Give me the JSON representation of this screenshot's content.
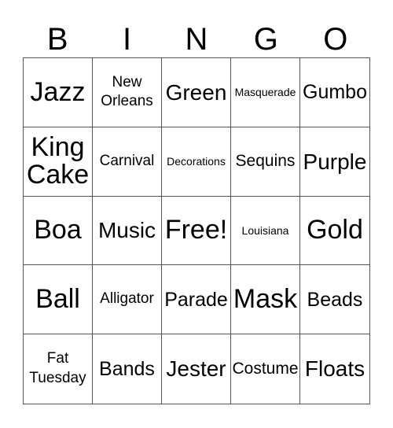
{
  "header": {
    "letters": [
      "B",
      "I",
      "N",
      "G",
      "O"
    ]
  },
  "cells": [
    {
      "text": "Jazz",
      "size": "s-xl"
    },
    {
      "text": "New Orleans",
      "size": "s-sm"
    },
    {
      "text": "Green",
      "size": "s-l"
    },
    {
      "text": "Masquerade",
      "size": "s-xs"
    },
    {
      "text": "Gumbo",
      "size": "s-m"
    },
    {
      "text": "King Cake",
      "size": "s-xl"
    },
    {
      "text": "Carnival",
      "size": "s-sm"
    },
    {
      "text": "Decorations",
      "size": "s-xs"
    },
    {
      "text": "Sequins",
      "size": "s-s"
    },
    {
      "text": "Purple",
      "size": "s-l"
    },
    {
      "text": "Boa",
      "size": "s-xl"
    },
    {
      "text": "Music",
      "size": "s-l"
    },
    {
      "text": "Free!",
      "size": "s-xl"
    },
    {
      "text": "Louisiana",
      "size": "s-xs"
    },
    {
      "text": "Gold",
      "size": "s-xl"
    },
    {
      "text": "Ball",
      "size": "s-xl"
    },
    {
      "text": "Alligator",
      "size": "s-sm"
    },
    {
      "text": "Parade",
      "size": "s-m"
    },
    {
      "text": "Mask",
      "size": "s-xl"
    },
    {
      "text": "Beads",
      "size": "s-m"
    },
    {
      "text": "Fat Tuesday",
      "size": "s-sm"
    },
    {
      "text": "Bands",
      "size": "s-m"
    },
    {
      "text": "Jester",
      "size": "s-l"
    },
    {
      "text": "Costume",
      "size": "s-s"
    },
    {
      "text": "Floats",
      "size": "s-l"
    }
  ]
}
